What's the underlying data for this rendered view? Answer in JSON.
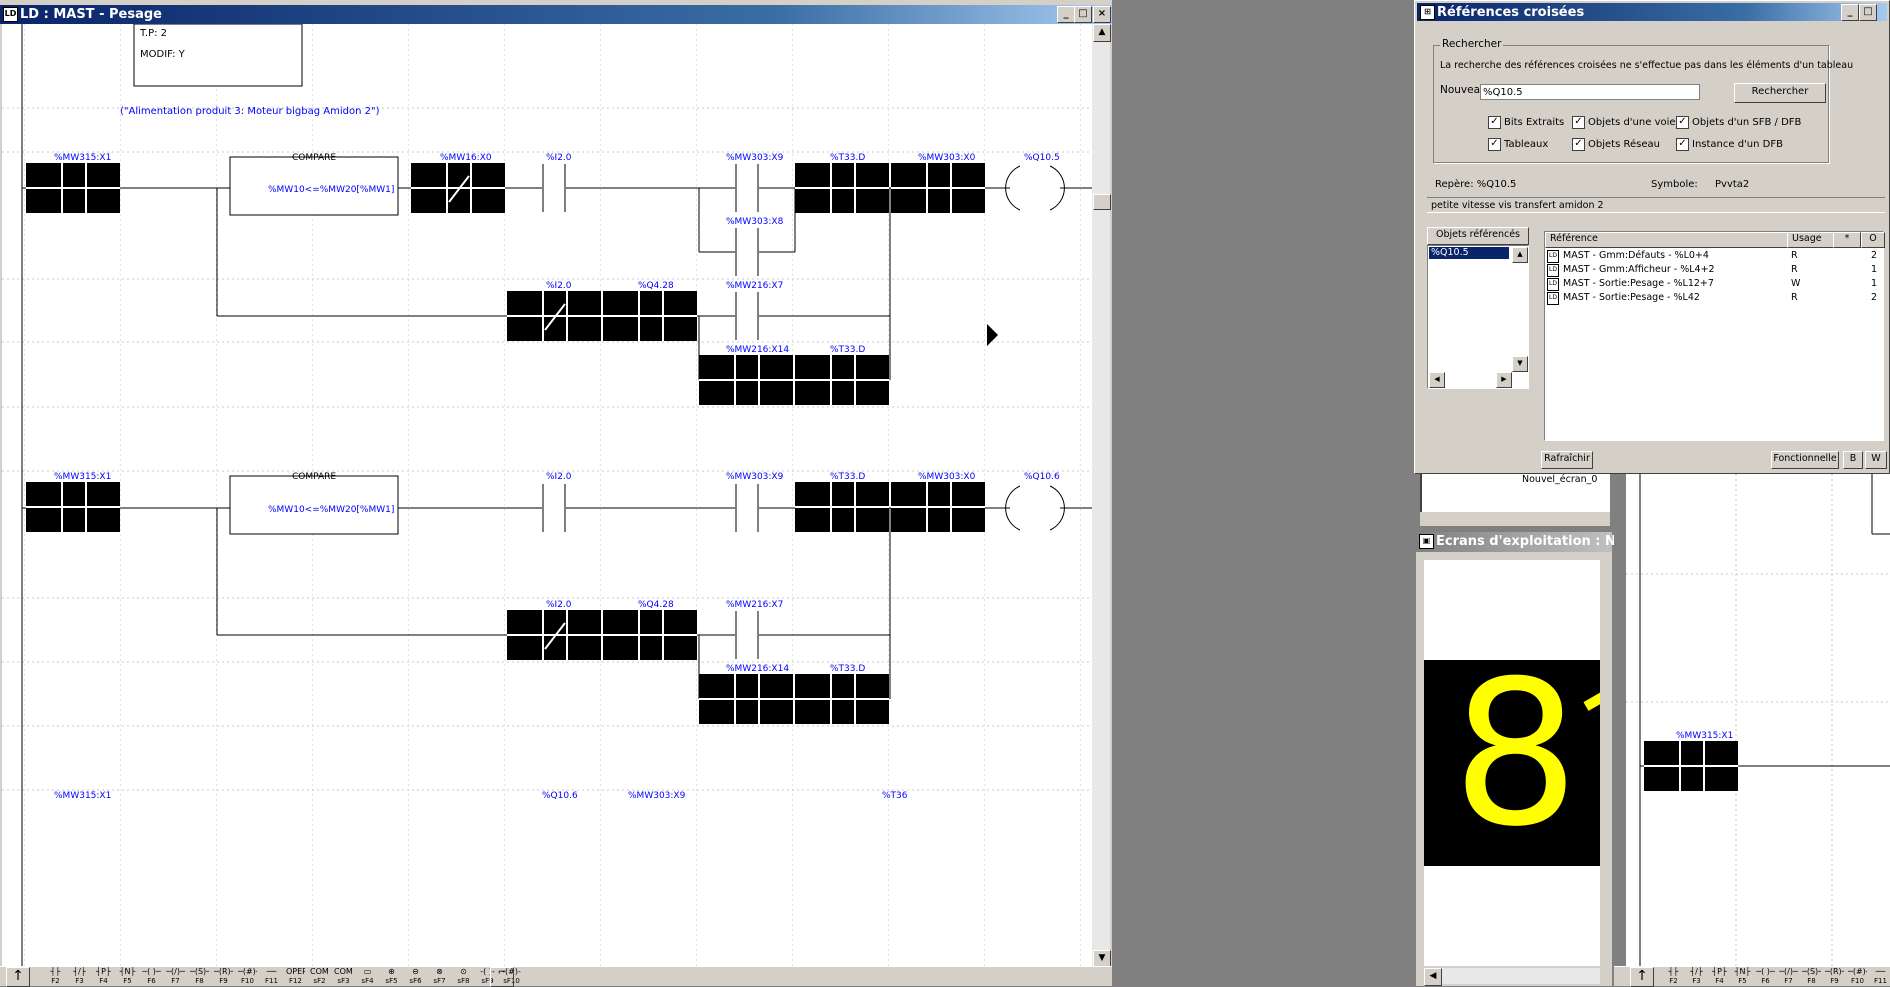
{
  "ld_window": {
    "title": "LD : MAST - Pesage",
    "tp_label": "T.P: 2",
    "modif_label": "MODIF: Y",
    "comment": "(\"Alimentation produit 3: Moteur bigbag Amidon 2\")",
    "rung1": {
      "c1": "%MW315:X1",
      "compare_title": "COMPARE",
      "compare_expr": "%MW10<=%MW20[%MW1]",
      "c2": "%MW16:X0",
      "c3": "%I2.0",
      "c4": "%MW303:X9",
      "c4b": "%MW303:X8",
      "c5": "%T33.D",
      "c6": "%MW303:X0",
      "coil": "%Q10.5",
      "r2c1": "%I2.0",
      "r2c2": "%Q4.28",
      "r2c3": "%MW216:X7",
      "r3c1": "%MW216:X14",
      "r3c2": "%T33.D"
    },
    "rung2": {
      "c1": "%MW315:X1",
      "compare_title": "COMPARE",
      "compare_expr": "%MW10<=%MW20[%MW1]",
      "c3": "%I2.0",
      "c4": "%MW303:X9",
      "c5": "%T33.D",
      "c6": "%MW303:X0",
      "coil": "%Q10.6",
      "r2c1": "%I2.0",
      "r2c2": "%Q4.28",
      "r2c3": "%MW216:X7",
      "r3c1": "%MW216:X14",
      "r3c2": "%T33.D"
    },
    "rung3_labels": [
      "%MW315:X1",
      "%Q10.6",
      "%MW303:X9",
      "%T36"
    ],
    "toolbar_labels": [
      "F2",
      "F3",
      "F4",
      "F5",
      "F6",
      "F7",
      "F8",
      "F9",
      "F10",
      "F11",
      "F12",
      "sF2",
      "sF3",
      "sF4",
      "sF5",
      "sF6",
      "sF7",
      "sF8",
      "sF9",
      "sF10"
    ]
  },
  "xref_window": {
    "title": "Références croisées",
    "group_label": "Rechercher",
    "info_text": "La recherche des références croisées ne s'effectue pas dans les éléments d'un tableau",
    "new_label": "Nouveau",
    "search_value": "%Q10.5",
    "search_button": "Rechercher",
    "checkboxes": [
      {
        "label": "Bits Extraits",
        "checked": true
      },
      {
        "label": "Objets d'une voie",
        "checked": true
      },
      {
        "label": "Objets d'un SFB / DFB",
        "checked": true
      },
      {
        "label": "Tableaux",
        "checked": true
      },
      {
        "label": "Objets Réseau",
        "checked": true
      },
      {
        "label": "Instance d'un DFB",
        "checked": true
      }
    ],
    "repere_label": "Repère: %Q10.5",
    "symbole_label": "Symbole:",
    "symbole_value": "Pvvta2",
    "comment": "petite vitesse vis transfert amidon 2",
    "objects_header": "Objets référencés",
    "objects": [
      "%Q10.5"
    ],
    "columns": [
      "Référence",
      "Usage",
      "*",
      "O"
    ],
    "rows": [
      {
        "ref": "MAST - Gmm:Défauts - %L0+4",
        "usage": "R",
        "o": "2"
      },
      {
        "ref": "MAST - Gmm:Afficheur - %L4+2",
        "usage": "R",
        "o": "1"
      },
      {
        "ref": "MAST - Sortie:Pesage - %L12+7",
        "usage": "W",
        "o": "1"
      },
      {
        "ref": "MAST - Sortie:Pesage - %L42",
        "usage": "R",
        "o": "2"
      }
    ],
    "refresh_button": "Rafraîchir",
    "functional_button": "Fonctionnelle",
    "b_button": "B",
    "w_button": "W"
  },
  "screens_window": {
    "title": "Ecrans d'exploitation : Nouve",
    "tree_item": "Nouvel_écran_0",
    "display_value": "8"
  },
  "right_ld": {
    "label": "%MW315:X1"
  },
  "colors": {
    "title_bar": "#0a246a",
    "label_blue": "#0000ff",
    "display_yellow": "#ffff00",
    "contact_black": "#000000"
  }
}
